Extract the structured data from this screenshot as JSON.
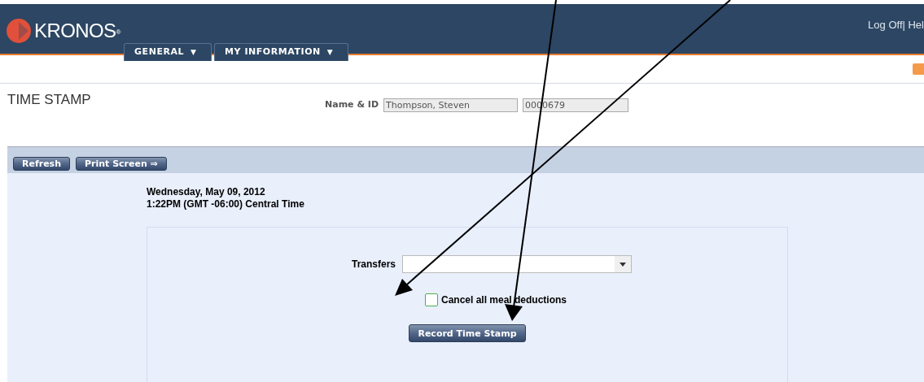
{
  "header": {
    "logo": "KRONOS",
    "logo_mark": "®",
    "tabs": [
      {
        "label": "GENERAL",
        "caret": "▼"
      },
      {
        "label": "MY INFORMATION",
        "caret": "▼"
      }
    ],
    "links": "Log Off| Hel"
  },
  "page": {
    "title": "TIME STAMP",
    "name_id_label": "Name & ID",
    "name": "Thompson, Steven",
    "id": "0000679"
  },
  "toolbar": [
    "Refresh",
    "Print Screen ⇒"
  ],
  "datetime": {
    "date": "Wednesday, May 09, 2012",
    "time": "1:22PM (GMT -06:00) Central Time"
  },
  "form": {
    "transfers_label": "Transfers",
    "cancel_meal": {
      "label": "Cancel all meal deductions",
      "checked": false
    },
    "submit": "Record Time Stamp"
  }
}
